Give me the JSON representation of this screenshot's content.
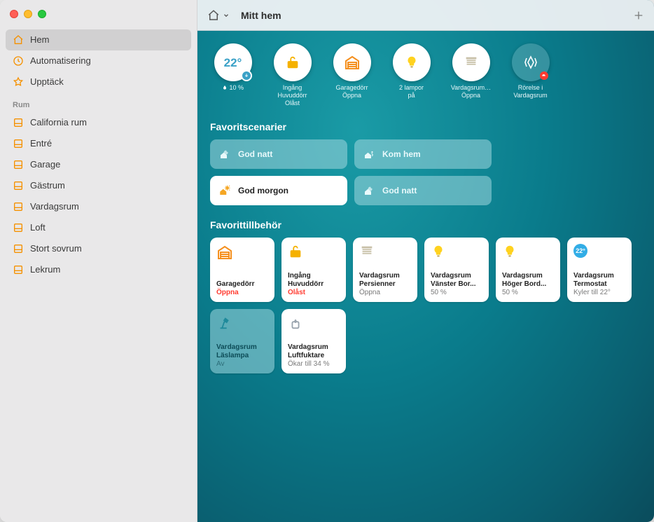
{
  "header": {
    "title": "Mitt hem"
  },
  "sidebar": {
    "main": [
      {
        "id": "home",
        "label": "Hem",
        "icon": "home-icon",
        "active": true
      },
      {
        "id": "auto",
        "label": "Automatisering",
        "icon": "clock-icon",
        "active": false
      },
      {
        "id": "discover",
        "label": "Upptäck",
        "icon": "star-icon",
        "active": false
      }
    ],
    "rooms_header": "Rum",
    "rooms": [
      {
        "label": "California rum"
      },
      {
        "label": "Entré"
      },
      {
        "label": "Garage"
      },
      {
        "label": "Gästrum"
      },
      {
        "label": "Vardagsrum"
      },
      {
        "label": "Loft"
      },
      {
        "label": "Stort sovrum"
      },
      {
        "label": "Lekrum"
      }
    ]
  },
  "status": {
    "climate": {
      "temp": "22°",
      "humidity_label": "10 %"
    },
    "items": [
      {
        "id": "entry-lock",
        "line1": "Ingång Huvuddörr",
        "line2": "Olåst",
        "icon": "unlock-icon",
        "tint": "#f5b100"
      },
      {
        "id": "garage-door",
        "line1": "Garagedörr",
        "line2": "Öppna",
        "icon": "garage-icon",
        "tint": "#f5901e"
      },
      {
        "id": "lights-on",
        "line1": "2 lampor",
        "line2": "på",
        "icon": "bulb-icon",
        "tint": "#ffd21f"
      },
      {
        "id": "blinds-open",
        "line1": "Vardagsrum…",
        "line2": "Öppna",
        "icon": "blinds-icon",
        "tint": "#c8c0a8"
      },
      {
        "id": "motion",
        "line1": "Rörelse i",
        "line2": "Vardagsrum",
        "icon": "motion-icon",
        "transp": true,
        "alert": true
      }
    ]
  },
  "sections": {
    "scenes": "Favoritscenarier",
    "accessories": "Favorittillbehör"
  },
  "scenes": [
    {
      "label": "God natt",
      "icon": "night-home-icon",
      "active": false
    },
    {
      "label": "Kom hem",
      "icon": "arrive-home-icon",
      "active": false
    },
    {
      "label": "God morgon",
      "icon": "morning-home-icon",
      "active": true
    },
    {
      "label": "God natt",
      "icon": "night-home-icon",
      "active": false
    }
  ],
  "accessories": [
    {
      "id": "garage",
      "icon": "garage-icon",
      "tint": "#f5901e",
      "t1": "Garagedörr",
      "t2": "",
      "t3": "Öppna",
      "warn": true
    },
    {
      "id": "entry-lock",
      "icon": "unlock-icon",
      "tint": "#f5b100",
      "t1": "Ingång",
      "t2": "Huvuddörr",
      "t3": "Olåst",
      "warn": true
    },
    {
      "id": "blinds",
      "icon": "blinds-icon",
      "tint": "#c8c0a8",
      "t1": "Vardagsrum",
      "t2": "Persienner",
      "t3": "Öppna"
    },
    {
      "id": "lamp-left",
      "icon": "bulb-icon",
      "tint": "#ffd21f",
      "t1": "Vardagsrum",
      "t2": "Vänster Bor...",
      "t3": "50 %"
    },
    {
      "id": "lamp-right",
      "icon": "bulb-icon",
      "tint": "#ffd21f",
      "t1": "Vardagsrum",
      "t2": "Höger Bord...",
      "t3": "50 %"
    },
    {
      "id": "thermostat",
      "icon": "pill22",
      "tint": "#32ade6",
      "t1": "Vardagsrum",
      "t2": "Termostat",
      "t3": "Kyler till 22°",
      "pill": "22°"
    },
    {
      "id": "reading",
      "icon": "desk-lamp-icon",
      "tint": "#1f8a9b",
      "t1": "Vardagsrum",
      "t2": "Läslampa",
      "t3": "Av",
      "off": true
    },
    {
      "id": "humidifier",
      "icon": "humidifier-icon",
      "tint": "#9aa4ae",
      "t1": "Vardagsrum",
      "t2": "Luftfuktare",
      "t3": "Ökar till 34 %"
    }
  ]
}
